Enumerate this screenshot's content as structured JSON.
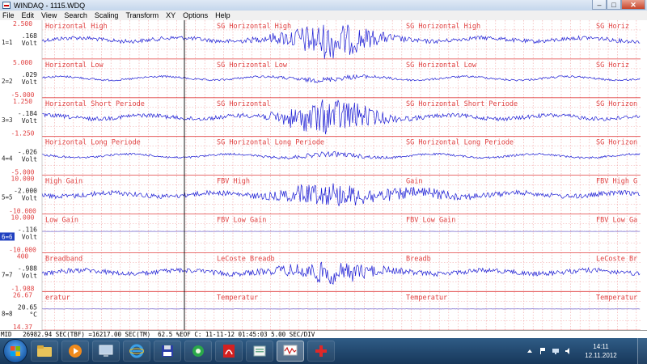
{
  "window": {
    "title": "WINDAQ - 1115.WDQ",
    "minimize_glyph": "–",
    "maximize_glyph": "□",
    "close_glyph": "✕"
  },
  "menu": [
    "File",
    "Edit",
    "View",
    "Search",
    "Scaling",
    "Transform",
    "XY",
    "Options",
    "Help"
  ],
  "colors": {
    "trace": "#1c1cd4",
    "label": "#e04040",
    "grid": "#f0a0a0",
    "cursor": "#000000",
    "flat_trace": "#7060c8",
    "selected_channel_bg": "#2040c0"
  },
  "channels": [
    {
      "id": "1=1",
      "top": "2.500",
      "value": ".168",
      "bottom": "",
      "unit": "Volt",
      "labels": [
        "Horizontal High",
        "SG Horizontal High",
        "SG Horizontal High",
        "SG Horiz"
      ],
      "style": "burst",
      "selected": false
    },
    {
      "id": "2=2",
      "top": "5.000",
      "value": ".029",
      "bottom": "-5.000",
      "unit": "Volt",
      "labels": [
        "Horizontal Low",
        "SG Horizontal Low",
        "SG Horizontal Low",
        "SG Horiz"
      ],
      "style": "low",
      "selected": false
    },
    {
      "id": "3=3",
      "top": "1.250",
      "value": "-.184",
      "bottom": "-1.250",
      "unit": "Volt",
      "labels": [
        "Horizontal Short Periode",
        "SG Horizontal",
        "SG Horizontal Short Periode",
        "SG Horizon"
      ],
      "style": "burst",
      "selected": false
    },
    {
      "id": "4=4",
      "top": "",
      "value": "-.026",
      "bottom": "-5.000",
      "unit": "Volt",
      "labels": [
        "Horizontal Long Periode",
        "SG Horizontal Long Periode",
        "SG Horizontal Long Periode",
        "SG Horizon"
      ],
      "style": "low",
      "selected": false
    },
    {
      "id": "5=5",
      "top": "10.000",
      "value": "-2.000",
      "bottom": "-10.000",
      "unit": "Volt",
      "labels": [
        "High Gain",
        "FBV High",
        "Gain",
        "FBV High G"
      ],
      "style": "wide",
      "selected": false
    },
    {
      "id": "6=6",
      "top": "10.000",
      "value": "-.116",
      "bottom": "-10.000",
      "unit": "Volt",
      "labels": [
        "Low Gain",
        "FBV Low Gain",
        "FBV Low Gain",
        "FBV Low Ga"
      ],
      "style": "flat",
      "selected": true
    },
    {
      "id": "7=7",
      "top": "400",
      "value": "-.988",
      "bottom": "-1.988",
      "unit": "Volt",
      "labels": [
        "Breadband",
        "LeCoste Breadb",
        "Breadb",
        "LeCoste Br"
      ],
      "style": "medium",
      "selected": false
    },
    {
      "id": "8=8",
      "top": "26.67",
      "value": "20.65",
      "bottom": "14.37",
      "unit": "°C",
      "labels": [
        "eratur",
        "Temperatur",
        "Temperatur",
        "Temperatur"
      ],
      "style": "flat",
      "selected": false
    }
  ],
  "status": "MID   26982.94 SEC(TBF) =16217.00 SEC(TM)  62.5 %EOF C: 11-11-12 01:45:03 5.00 SEC/DIV",
  "taskbar": {
    "apps": [
      "explorer",
      "media-player",
      "remote-desktop",
      "internet-explorer",
      "floppy-save",
      "network-tool",
      "acrobat-reader",
      "file-manager",
      "windaq",
      "red-tool"
    ],
    "active_app": "windaq",
    "clock_time": "14:11",
    "clock_date": "12.11.2012"
  }
}
